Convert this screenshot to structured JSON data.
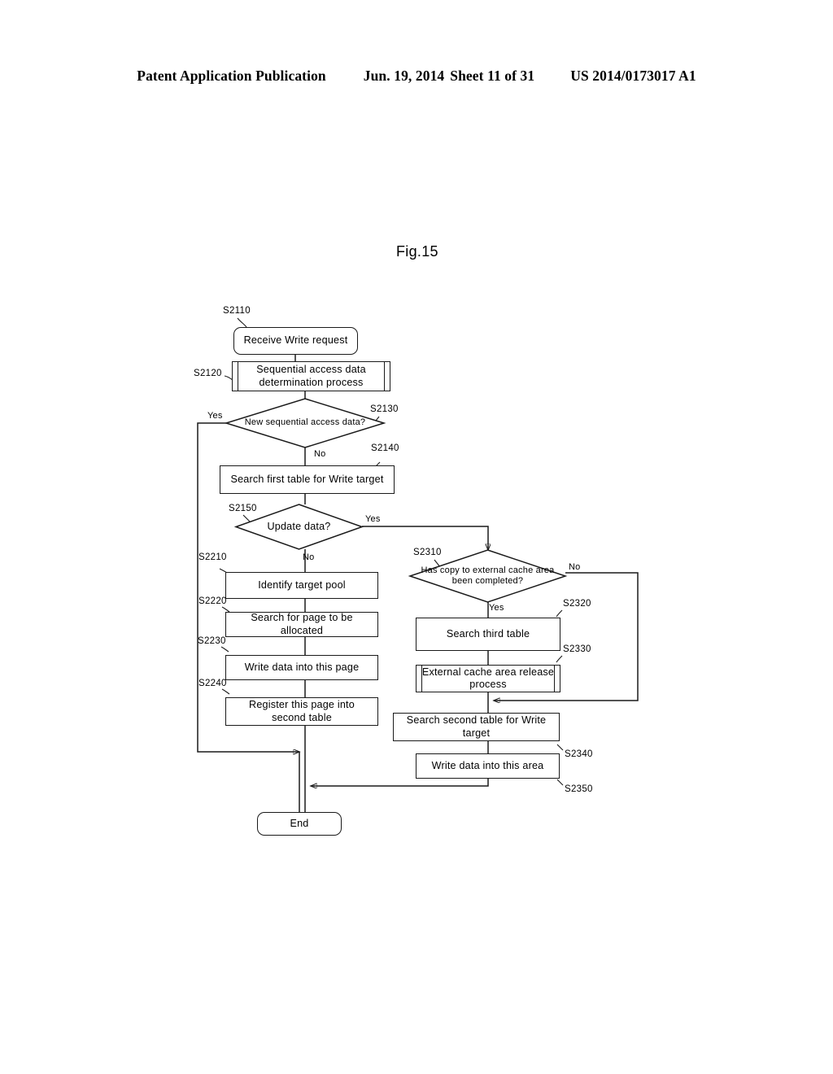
{
  "header": {
    "publication": "Patent Application Publication",
    "date": "Jun. 19, 2014",
    "sheet": "Sheet 11 of 31",
    "patent_number": "US 2014/0173017 A1"
  },
  "figure": {
    "title": "Fig.15"
  },
  "flowchart": {
    "type": "flowchart",
    "nodes": [
      {
        "id": "S2110",
        "shape": "terminator",
        "text": "Receive Write request"
      },
      {
        "id": "S2120",
        "shape": "subroutine",
        "text": "Sequential access data determination process"
      },
      {
        "id": "S2130",
        "shape": "decision",
        "text": "New sequential access data?"
      },
      {
        "id": "S2140",
        "shape": "process",
        "text": "Search first table for Write target"
      },
      {
        "id": "S2150",
        "shape": "decision",
        "text": "Update data?"
      },
      {
        "id": "S2210",
        "shape": "process",
        "text": "Identify target pool"
      },
      {
        "id": "S2220",
        "shape": "process",
        "text": "Search for page to be allocated"
      },
      {
        "id": "S2230",
        "shape": "process",
        "text": "Write data into this page"
      },
      {
        "id": "S2240",
        "shape": "process",
        "text": "Register this page into second table"
      },
      {
        "id": "S2310",
        "shape": "decision",
        "text": "Has copy to external cache area been completed?"
      },
      {
        "id": "S2320",
        "shape": "process",
        "text": "Search third table"
      },
      {
        "id": "S2330",
        "shape": "subroutine",
        "text": "External cache area release process"
      },
      {
        "id": "S2340",
        "shape": "process",
        "text": "Search second table for Write target"
      },
      {
        "id": "S2350",
        "shape": "process",
        "text": "Write data into this area"
      },
      {
        "id": "END",
        "shape": "terminator",
        "text": "End"
      }
    ],
    "branch_labels": {
      "s2130_yes": "Yes",
      "s2130_no": "No",
      "s2150_yes": "Yes",
      "s2150_no": "No",
      "s2310_no": "No",
      "s2310_yes": "Yes"
    },
    "step_labels": {
      "s2110": "S2110",
      "s2120": "S2120",
      "s2130": "S2130",
      "s2140": "S2140",
      "s2150": "S2150",
      "s2210": "S2210",
      "s2220": "S2220",
      "s2230": "S2230",
      "s2240": "S2240",
      "s2310": "S2310",
      "s2320": "S2320",
      "s2330": "S2330",
      "s2340": "S2340",
      "s2350": "S2350"
    }
  }
}
